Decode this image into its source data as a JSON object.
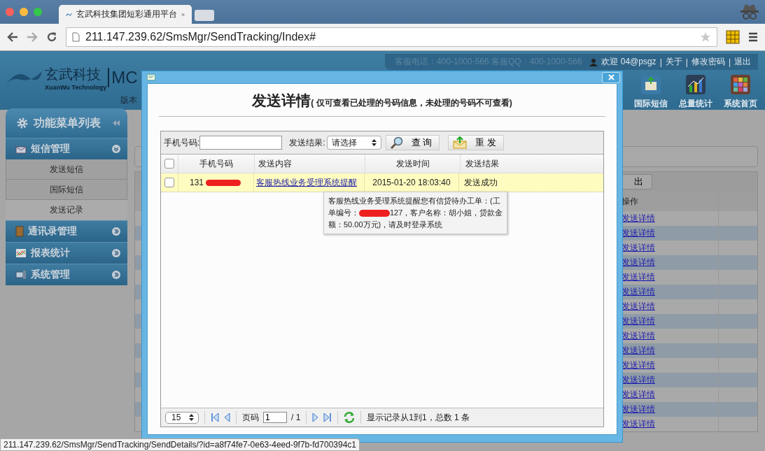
{
  "browser": {
    "tab_title": "玄武科技集团短彩通用平台",
    "url": "211.147.239.62/SmsMgr/SendTracking/Index#",
    "status_url": "211.147.239.62/SmsMgr/SendTracking/SendDetails/?id=a8f74fe7-0e63-4eed-9f7b-fd700394c1"
  },
  "header": {
    "logo_cn": "玄武科技",
    "logo_en": "XuanWu Technology",
    "logo_product": "MC",
    "version": "版本",
    "contacts": "客服电话：400-1000-566  客服QQ：400-1000-566",
    "welcome": "欢迎 04@psgz",
    "separator": "|",
    "links": [
      "关于",
      "修改密码",
      "退出"
    ],
    "nav": [
      {
        "label": "国际短信"
      },
      {
        "label": "总量统计"
      },
      {
        "label": "系统首页"
      }
    ]
  },
  "sidebar": {
    "title": "功能菜单列表",
    "groups": [
      {
        "label": "短信管理",
        "expanded": true,
        "children": [
          {
            "label": "发送短信",
            "selected": false
          },
          {
            "label": "国际短信",
            "selected": false
          },
          {
            "label": "发送记录",
            "selected": true
          }
        ]
      },
      {
        "label": "通讯录管理",
        "expanded": false
      },
      {
        "label": "报表统计",
        "expanded": false
      },
      {
        "label": "系统管理",
        "expanded": false
      }
    ]
  },
  "background_table": {
    "export_button": "出",
    "column": "操作",
    "links": [
      "发送详情",
      "发送详情",
      "发送详情",
      "发送详情",
      "发送详情",
      "发送详情",
      "发送详情",
      "发送详情",
      "发送详情",
      "发送详情",
      "发送详情",
      "发送详情",
      "发送详情",
      "发送详情",
      "发送详情"
    ]
  },
  "dialog": {
    "title": "发送详情",
    "note": "( 仅可查看已处理的号码信息，未处理的号码不可查看)",
    "filter": {
      "phone_label": "手机号码:",
      "result_label": "发送结果:",
      "result_value": "请选择",
      "query_button": "查 询",
      "resend_button": "重 发"
    },
    "grid": {
      "header_checked": false,
      "columns": [
        "手机号码",
        "发送内容",
        "发送时间",
        "发送结果"
      ],
      "rows": [
        {
          "checked": false,
          "phone": "131",
          "content": "客服热线业务受理系统提醒",
          "time": "2015-01-20 18:03:40",
          "result": "发送成功"
        }
      ]
    },
    "tooltip": {
      "line_1": "客服热线业务受理系统提醒您有信贷待办工单：(工",
      "line_2_before": "单编号：",
      "line_2_after": "127，客户名称：胡小姐，贷款金",
      "line_3": "额：50.00万元)，请及时登录系统"
    },
    "pager": {
      "page_size": "15",
      "page_label": "页码",
      "page": "1",
      "total_pages": "/ 1",
      "summary": "显示记录从1到1，总数 1 条"
    }
  }
}
